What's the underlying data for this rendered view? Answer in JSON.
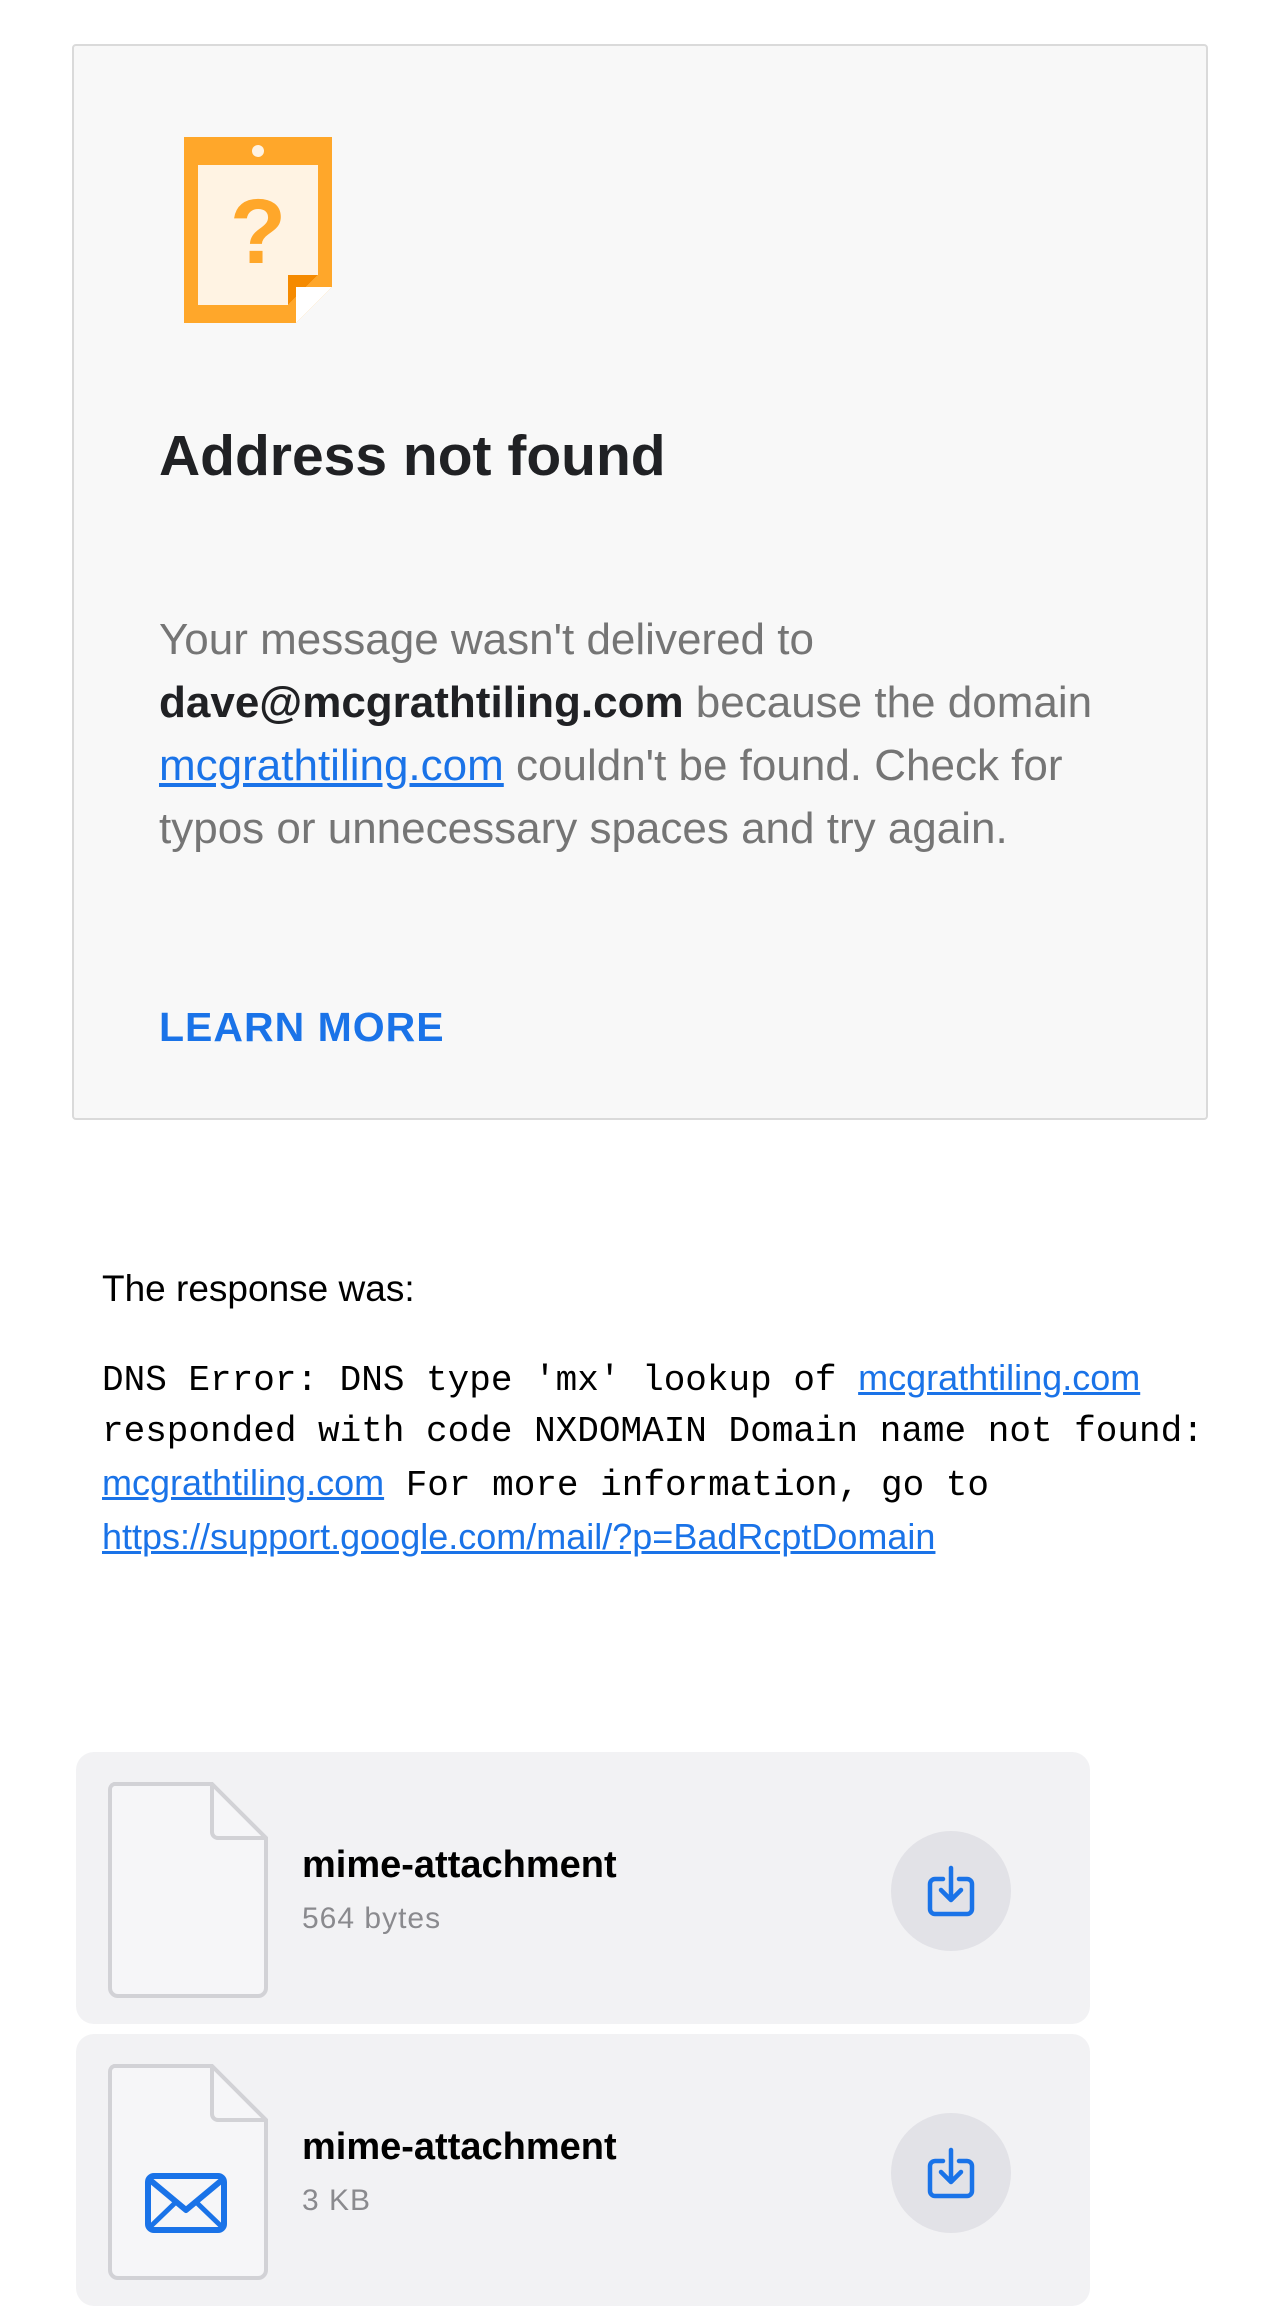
{
  "bounce": {
    "icon": "warning-note-icon",
    "title": "Address not found",
    "message": {
      "part1": "Your message wasn't delivered to ",
      "recipient": "dave@mcgrathtiling.com",
      "part2": " because the domain ",
      "domain_link": "mcgrathtiling.com",
      "part3": " couldn't be found. Check for typos or unnecessary spaces and try again."
    },
    "learn_more_label": "LEARN MORE"
  },
  "response": {
    "label": "The response was:",
    "part1": "DNS Error: DNS type 'mx' lookup of ",
    "domain_link_1": "mcgrathtiling.com",
    "part2": " responded with code NXDOMAIN Domain name not found: ",
    "domain_link_2": "mcgrathtiling.com",
    "part3": " For more information, go to ",
    "support_link": "https://support.google.com/mail/?p=BadRcptDomain"
  },
  "attachments": [
    {
      "name": "mime-attachment",
      "size": "564 bytes",
      "icon": "blank-file-icon"
    },
    {
      "name": "mime-attachment",
      "size": "3 KB",
      "icon": "envelope-icon"
    }
  ],
  "colors": {
    "accent": "#1a73e8",
    "warning_orange": "#ffa72a",
    "card_background": "#f8f8f8",
    "attachment_background": "#f2f2f4"
  }
}
